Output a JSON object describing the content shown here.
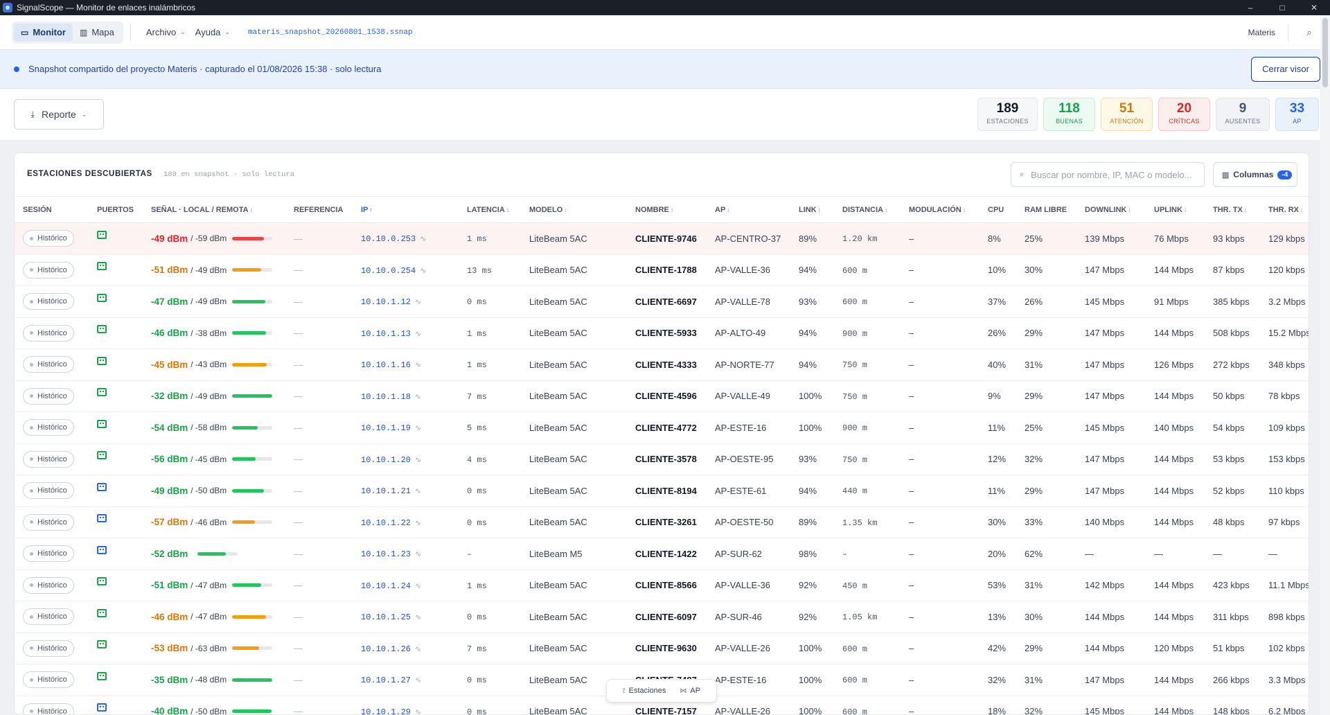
{
  "window": {
    "title": "SignalScope — Monitor de enlaces inalámbricos",
    "controls": [
      "–",
      "□",
      "✕"
    ]
  },
  "toolbar": {
    "view_monitor": "Monitor",
    "view_map": "Mapa",
    "menu_file": "Archivo",
    "menu_help": "Ayuda",
    "file_name": "materis_snapshot_20260801_1538.ssnap",
    "user": "Materis"
  },
  "banner": {
    "text": "Snapshot compartido del proyecto Materis · capturado el 01/08/2026 15:38 · solo lectura",
    "close_label": "Cerrar visor"
  },
  "actions": {
    "report_label": "Reporte"
  },
  "stats": [
    {
      "num": "189",
      "label": "ESTACIONES"
    },
    {
      "num": "118",
      "label": "BUENAS"
    },
    {
      "num": "51",
      "label": "ATENCIÓN"
    },
    {
      "num": "20",
      "label": "CRÍTICAS"
    },
    {
      "num": "9",
      "label": "AUSENTES"
    },
    {
      "num": "33",
      "label": "AP"
    }
  ],
  "panel": {
    "title": "ESTACIONES DESCUBIERTAS",
    "subtitle": "189 en snapshot · solo lectura",
    "search_placeholder": "Buscar por nombre, IP, MAC o modelo...",
    "columns_label": "Columnas",
    "columns_badge": "-4"
  },
  "columns": [
    "SESIÓN",
    "PUERTOS",
    "SEÑAL · LOCAL / REMOTA",
    "REFERENCIA",
    "IP",
    "LATENCIA",
    "MODELO",
    "NOMBRE",
    "AP",
    "LINK",
    "DISTANCIA",
    "MODULACIÓN",
    "CPU",
    "RAM LIBRE",
    "DOWNLINK",
    "UPLINK",
    "THR. TX",
    "THR. RX"
  ],
  "row_action": "Histórico",
  "rows": [
    {
      "port": "g",
      "status": "red",
      "local": "-49 dBm",
      "remote": "/ -59 dBm",
      "level": 0.78,
      "ref": "—",
      "ip": "10.10.0.253",
      "lat": "1 ms",
      "model": "LiteBeam 5AC",
      "name": "CLIENTE-9746",
      "ap": "AP-CENTRO-37",
      "link": "89%",
      "dist": "1.20 km",
      "mod": "–",
      "cpu": "8%",
      "ram": "25%",
      "down": "139 Mbps",
      "up": "76 Mbps",
      "tx": "93 kbps",
      "rx": "129 kbps"
    },
    {
      "port": "g",
      "status": "amber",
      "local": "-51 dBm",
      "remote": "/ -49 dBm",
      "level": 0.72,
      "ref": "—",
      "ip": "10.10.0.254",
      "lat": "13 ms",
      "model": "LiteBeam 5AC",
      "name": "CLIENTE-1788",
      "ap": "AP-VALLE-36",
      "link": "94%",
      "dist": "600 m",
      "mod": "–",
      "cpu": "10%",
      "ram": "30%",
      "down": "147 Mbps",
      "up": "144 Mbps",
      "tx": "87 kbps",
      "rx": "120 kbps"
    },
    {
      "port": "g",
      "status": "green",
      "local": "-47 dBm",
      "remote": "/ -49 dBm",
      "level": 0.82,
      "ref": "—",
      "ip": "10.10.1.12",
      "lat": "0 ms",
      "model": "LiteBeam 5AC",
      "name": "CLIENTE-6697",
      "ap": "AP-VALLE-78",
      "link": "93%",
      "dist": "600 m",
      "mod": "–",
      "cpu": "37%",
      "ram": "26%",
      "down": "145 Mbps",
      "up": "91 Mbps",
      "tx": "385 kbps",
      "rx": "3.2 Mbps"
    },
    {
      "port": "g",
      "status": "green",
      "local": "-46 dBm",
      "remote": "/ -38 dBm",
      "level": 0.84,
      "ref": "—",
      "ip": "10.10.1.13",
      "lat": "1 ms",
      "model": "LiteBeam 5AC",
      "name": "CLIENTE-5933",
      "ap": "AP-ALTO-49",
      "link": "94%",
      "dist": "900 m",
      "mod": "–",
      "cpu": "26%",
      "ram": "29%",
      "down": "147 Mbps",
      "up": "144 Mbps",
      "tx": "508 kbps",
      "rx": "15.2 Mbps"
    },
    {
      "port": "g",
      "status": "amber",
      "local": "-45 dBm",
      "remote": "/ -43 dBm",
      "level": 0.86,
      "ref": "—",
      "ip": "10.10.1.16",
      "lat": "1 ms",
      "model": "LiteBeam 5AC",
      "name": "CLIENTE-4333",
      "ap": "AP-NORTE-77",
      "link": "94%",
      "dist": "750 m",
      "mod": "–",
      "cpu": "40%",
      "ram": "31%",
      "down": "147 Mbps",
      "up": "126 Mbps",
      "tx": "272 kbps",
      "rx": "348 kbps"
    },
    {
      "port": "g",
      "status": "green",
      "local": "-32 dBm",
      "remote": "/ -49 dBm",
      "level": 1.0,
      "ref": "—",
      "ip": "10.10.1.18",
      "lat": "7 ms",
      "model": "LiteBeam 5AC",
      "name": "CLIENTE-4596",
      "ap": "AP-VALLE-49",
      "link": "100%",
      "dist": "750 m",
      "mod": "–",
      "cpu": "9%",
      "ram": "29%",
      "down": "147 Mbps",
      "up": "144 Mbps",
      "tx": "50 kbps",
      "rx": "78 kbps"
    },
    {
      "port": "g",
      "status": "green",
      "local": "-54 dBm",
      "remote": "/ -58 dBm",
      "level": 0.64,
      "ref": "—",
      "ip": "10.10.1.19",
      "lat": "5 ms",
      "model": "LiteBeam 5AC",
      "name": "CLIENTE-4772",
      "ap": "AP-ESTE-16",
      "link": "100%",
      "dist": "900 m",
      "mod": "–",
      "cpu": "11%",
      "ram": "25%",
      "down": "145 Mbps",
      "up": "140 Mbps",
      "tx": "54 kbps",
      "rx": "109 kbps"
    },
    {
      "port": "g",
      "status": "green",
      "local": "-56 dBm",
      "remote": "/ -45 dBm",
      "level": 0.58,
      "ref": "—",
      "ip": "10.10.1.20",
      "lat": "4 ms",
      "model": "LiteBeam 5AC",
      "name": "CLIENTE-3578",
      "ap": "AP-OESTE-95",
      "link": "93%",
      "dist": "750 m",
      "mod": "–",
      "cpu": "12%",
      "ram": "32%",
      "down": "147 Mbps",
      "up": "144 Mbps",
      "tx": "53 kbps",
      "rx": "153 kbps"
    },
    {
      "port": "b",
      "status": "green",
      "local": "-49 dBm",
      "remote": "/ -50 dBm",
      "level": 0.78,
      "ref": "—",
      "ip": "10.10.1.21",
      "lat": "0 ms",
      "model": "LiteBeam 5AC",
      "name": "CLIENTE-8194",
      "ap": "AP-ESTE-61",
      "link": "94%",
      "dist": "440 m",
      "mod": "–",
      "cpu": "11%",
      "ram": "29%",
      "down": "147 Mbps",
      "up": "144 Mbps",
      "tx": "52 kbps",
      "rx": "110 kbps"
    },
    {
      "port": "b",
      "status": "amber",
      "local": "-57 dBm",
      "remote": "/ -46 dBm",
      "level": 0.56,
      "ref": "—",
      "ip": "10.10.1.22",
      "lat": "0 ms",
      "model": "LiteBeam 5AC",
      "name": "CLIENTE-3261",
      "ap": "AP-OESTE-50",
      "link": "89%",
      "dist": "1.35 km",
      "mod": "–",
      "cpu": "30%",
      "ram": "33%",
      "down": "140 Mbps",
      "up": "144 Mbps",
      "tx": "48 kbps",
      "rx": "97 kbps"
    },
    {
      "port": "b",
      "status": "green",
      "local": "-52 dBm",
      "remote": "",
      "level": 0.7,
      "ref": "—",
      "ip": "10.10.1.23",
      "lat": "–",
      "model": "LiteBeam M5",
      "name": "CLIENTE-1422",
      "ap": "AP-SUR-62",
      "link": "98%",
      "dist": "–",
      "mod": "–",
      "cpu": "20%",
      "ram": "62%",
      "down": "—",
      "up": "—",
      "tx": "—",
      "rx": "—"
    },
    {
      "port": "g",
      "status": "green",
      "local": "-51 dBm",
      "remote": "/ -47 dBm",
      "level": 0.72,
      "ref": "—",
      "ip": "10.10.1.24",
      "lat": "1 ms",
      "model": "LiteBeam 5AC",
      "name": "CLIENTE-8566",
      "ap": "AP-VALLE-36",
      "link": "92%",
      "dist": "450 m",
      "mod": "–",
      "cpu": "53%",
      "ram": "31%",
      "down": "142 Mbps",
      "up": "144 Mbps",
      "tx": "423 kbps",
      "rx": "11.1 Mbps"
    },
    {
      "port": "g",
      "status": "amber",
      "local": "-46 dBm",
      "remote": "/ -47 dBm",
      "level": 0.84,
      "ref": "—",
      "ip": "10.10.1.25",
      "lat": "0 ms",
      "model": "LiteBeam 5AC",
      "name": "CLIENTE-6097",
      "ap": "AP-SUR-46",
      "link": "92%",
      "dist": "1.05 km",
      "mod": "–",
      "cpu": "13%",
      "ram": "30%",
      "down": "144 Mbps",
      "up": "144 Mbps",
      "tx": "311 kbps",
      "rx": "898 kbps"
    },
    {
      "port": "g",
      "status": "amber",
      "local": "-53 dBm",
      "remote": "/ -63 dBm",
      "level": 0.66,
      "ref": "—",
      "ip": "10.10.1.26",
      "lat": "7 ms",
      "model": "LiteBeam 5AC",
      "name": "CLIENTE-9630",
      "ap": "AP-VALLE-26",
      "link": "100%",
      "dist": "600 m",
      "mod": "–",
      "cpu": "42%",
      "ram": "29%",
      "down": "144 Mbps",
      "up": "120 Mbps",
      "tx": "51 kbps",
      "rx": "102 kbps"
    },
    {
      "port": "g",
      "status": "green",
      "local": "-35 dBm",
      "remote": "/ -48 dBm",
      "level": 1.0,
      "ref": "—",
      "ip": "10.10.1.27",
      "lat": "0 ms",
      "model": "LiteBeam 5AC",
      "name": "CLIENTE-7487",
      "ap": "AP-ESTE-16",
      "link": "100%",
      "dist": "600 m",
      "mod": "–",
      "cpu": "32%",
      "ram": "31%",
      "down": "147 Mbps",
      "up": "144 Mbps",
      "tx": "266 kbps",
      "rx": "3.3 Mbps"
    },
    {
      "port": "b",
      "status": "green",
      "local": "-40 dBm",
      "remote": "/ -50 dBm",
      "level": 0.98,
      "ref": "—",
      "ip": "10.10.1.29",
      "lat": "0 ms",
      "model": "LiteBeam 5AC",
      "name": "CLIENTE-7157",
      "ap": "AP-VALLE-26",
      "link": "100%",
      "dist": "600 m",
      "mod": "–",
      "cpu": "18%",
      "ram": "32%",
      "down": "145 Mbps",
      "up": "144 Mbps",
      "tx": "148 kbps",
      "rx": "6.2 Mbps"
    }
  ],
  "floatnav": {
    "stations": "Estaciones",
    "ap": "AP"
  }
}
